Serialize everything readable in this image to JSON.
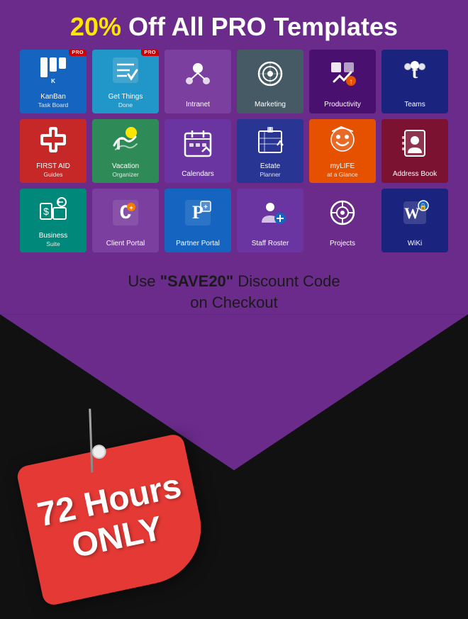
{
  "header": {
    "title_normal": "Off All PRO Templates",
    "title_highlight": "20%"
  },
  "discount": {
    "line1": "Use “SAVE20” Discount Code",
    "line2": "on Checkout"
  },
  "tag": {
    "line1": "72 Hours",
    "line2": "ONLY"
  },
  "tiles": [
    {
      "id": "kanban",
      "label": "KanBan\nTask Board",
      "label1": "KanBan",
      "label2": "Task Board",
      "color": "blue",
      "pro": true,
      "icon": "kanban"
    },
    {
      "id": "getthings",
      "label": "Get Things\nDone",
      "label1": "Get Things",
      "label2": "Done",
      "color": "blue2",
      "pro": true,
      "icon": "check"
    },
    {
      "id": "intranet",
      "label": "Intranet",
      "label1": "Intranet",
      "label2": "",
      "color": "purple",
      "pro": false,
      "icon": "people"
    },
    {
      "id": "marketing",
      "label": "Marketing",
      "label1": "Marketing",
      "label2": "",
      "color": "slate",
      "pro": false,
      "icon": "target"
    },
    {
      "id": "productivity",
      "label": "Productivity",
      "label1": "Productivity",
      "label2": "",
      "color": "darkpurple",
      "pro": false,
      "icon": "productivity"
    },
    {
      "id": "teams",
      "label": "Teams",
      "label1": "Teams",
      "label2": "",
      "color": "navy",
      "pro": false,
      "icon": "teams"
    },
    {
      "id": "firstaid",
      "label": "FIRST AID\nGuides",
      "label1": "FIRST AID",
      "label2": "Guides",
      "color": "red",
      "pro": false,
      "icon": "firstaid"
    },
    {
      "id": "vacation",
      "label": "Vacation\nOrganizer",
      "label1": "Vacation",
      "label2": "Organizer",
      "color": "green2",
      "pro": false,
      "icon": "vacation"
    },
    {
      "id": "calendars",
      "label": "Calendars",
      "label1": "Calendars",
      "label2": "",
      "color": "purple2",
      "pro": false,
      "icon": "calendar"
    },
    {
      "id": "estate",
      "label": "Estate\nPlanner",
      "label1": "Estate",
      "label2": "Planner",
      "color": "indigo",
      "pro": false,
      "icon": "estate"
    },
    {
      "id": "mylife",
      "label": "myLIFE\nat a Glance",
      "label1": "myLIFE",
      "label2": "at a Glance",
      "color": "amber",
      "pro": false,
      "icon": "mylife"
    },
    {
      "id": "addressbook",
      "label": "Address Book",
      "label1": "Address Book",
      "label2": "",
      "color": "wine",
      "pro": false,
      "icon": "addressbook"
    },
    {
      "id": "business",
      "label": "Business\nSuite",
      "label1": "Business",
      "label2": "Suite",
      "color": "teal",
      "pro": false,
      "icon": "business"
    },
    {
      "id": "clientportal",
      "label": "Client Portal",
      "label1": "Client Portal",
      "label2": "",
      "color": "purple",
      "pro": false,
      "icon": "clientportal"
    },
    {
      "id": "partnerportal",
      "label": "Partner Portal",
      "label1": "Partner Portal",
      "label2": "",
      "color": "darkblue",
      "pro": false,
      "icon": "partnerportal"
    },
    {
      "id": "staffroster",
      "label": "Staff Roster",
      "label1": "Staff Roster",
      "label2": "",
      "color": "purple2",
      "pro": false,
      "icon": "staffroster"
    },
    {
      "id": "projects",
      "label": "Projects",
      "label1": "Projects",
      "label2": "",
      "color": "purple",
      "pro": false,
      "icon": "projects"
    },
    {
      "id": "wiki",
      "label": "WiKi",
      "label1": "WiKi",
      "label2": "",
      "color": "navy",
      "pro": false,
      "icon": "wiki"
    }
  ],
  "colors": {
    "blue": "#1565c0",
    "blue2": "#1e88e5",
    "purple": "#7b3fa0",
    "purple2": "#6a35a0",
    "darkpurple": "#4a1070",
    "teal": "#00897b",
    "green": "#2e7d32",
    "green2": "#2e7d32",
    "orange": "#e65100",
    "red": "#c62828",
    "darkteal": "#00695c",
    "indigo": "#283593",
    "darkblue": "#1565c0",
    "cyan": "#0097a7",
    "amber": "#e65100",
    "wine": "#7b1232",
    "navy": "#1a237e",
    "slate": "#455a64"
  }
}
